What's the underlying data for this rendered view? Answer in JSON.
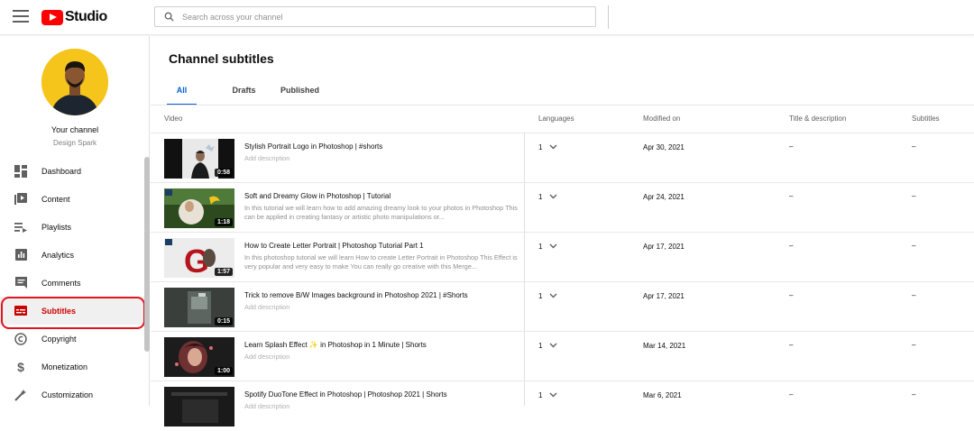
{
  "app": {
    "logo_text": "Studio"
  },
  "search": {
    "placeholder": "Search across your channel"
  },
  "channel": {
    "name": "Your channel",
    "handle": "Design Spark"
  },
  "sidebar": {
    "items": [
      {
        "label": "Dashboard",
        "icon": "dashboard-icon"
      },
      {
        "label": "Content",
        "icon": "content-icon"
      },
      {
        "label": "Playlists",
        "icon": "playlists-icon"
      },
      {
        "label": "Analytics",
        "icon": "analytics-icon"
      },
      {
        "label": "Comments",
        "icon": "comments-icon"
      },
      {
        "label": "Subtitles",
        "icon": "subtitles-icon",
        "active": true
      },
      {
        "label": "Copyright",
        "icon": "copyright-icon"
      },
      {
        "label": "Monetization",
        "icon": "monetization-icon"
      },
      {
        "label": "Customization",
        "icon": "customization-icon"
      }
    ]
  },
  "main": {
    "title": "Channel subtitles",
    "tabs": [
      {
        "label": "All",
        "selected": true
      },
      {
        "label": "Drafts"
      },
      {
        "label": "Published"
      }
    ],
    "columns": {
      "video": "Video",
      "languages": "Languages",
      "modified": "Modified on",
      "title_desc": "Title & description",
      "subtitles": "Subtitles"
    }
  },
  "videos": [
    {
      "title": "Stylish Portrait Logo in Photoshop | #shorts",
      "description": "Add description",
      "has_description": false,
      "duration": "0:58",
      "languages": "1",
      "modified": "Apr 30, 2021",
      "title_desc_status": "–",
      "subtitles_status": "–"
    },
    {
      "title": "Soft and Dreamy Glow in Photoshop | Tutorial",
      "description": "In this tutorial we will learn how to add amazing dreamy look to your photos in Photoshop This can be applied in creating fantasy or artistic photo manipulations or...",
      "has_description": true,
      "duration": "1:18",
      "languages": "1",
      "modified": "Apr 24, 2021",
      "title_desc_status": "–",
      "subtitles_status": "–"
    },
    {
      "title": "How to Create Letter Portrait | Photoshop Tutorial Part 1",
      "description": "In this photoshop tutorial we will learn How to create Letter Portrait in Photoshop This Effect is very popular and very easy to make You can really go creative with this Merge...",
      "has_description": true,
      "duration": "1:57",
      "languages": "1",
      "modified": "Apr 17, 2021",
      "title_desc_status": "–",
      "subtitles_status": "–"
    },
    {
      "title": "Trick to remove B/W Images background in Photoshop 2021 | #Shorts",
      "description": "Add description",
      "has_description": false,
      "duration": "0:15",
      "languages": "1",
      "modified": "Apr 17, 2021",
      "title_desc_status": "–",
      "subtitles_status": "–"
    },
    {
      "title": "Learn Splash Effect ✨ in Photoshop in 1 Minute | Shorts",
      "description": "Add description",
      "has_description": false,
      "duration": "1:00",
      "languages": "1",
      "modified": "Mar 14, 2021",
      "title_desc_status": "–",
      "subtitles_status": "–"
    },
    {
      "title": "Spotify DuoTone Effect in Photoshop | Photoshop 2021 | Shorts",
      "description": "Add description",
      "has_description": false,
      "duration": "",
      "languages": "1",
      "modified": "Mar 6, 2021",
      "title_desc_status": "–",
      "subtitles_status": "–"
    }
  ],
  "colors": {
    "brand_red": "#ff0000",
    "active_red": "#cc0000",
    "highlight_ring": "#e0141e",
    "tab_blue": "#065fd4",
    "avatar_bg": "#f6c51c"
  }
}
